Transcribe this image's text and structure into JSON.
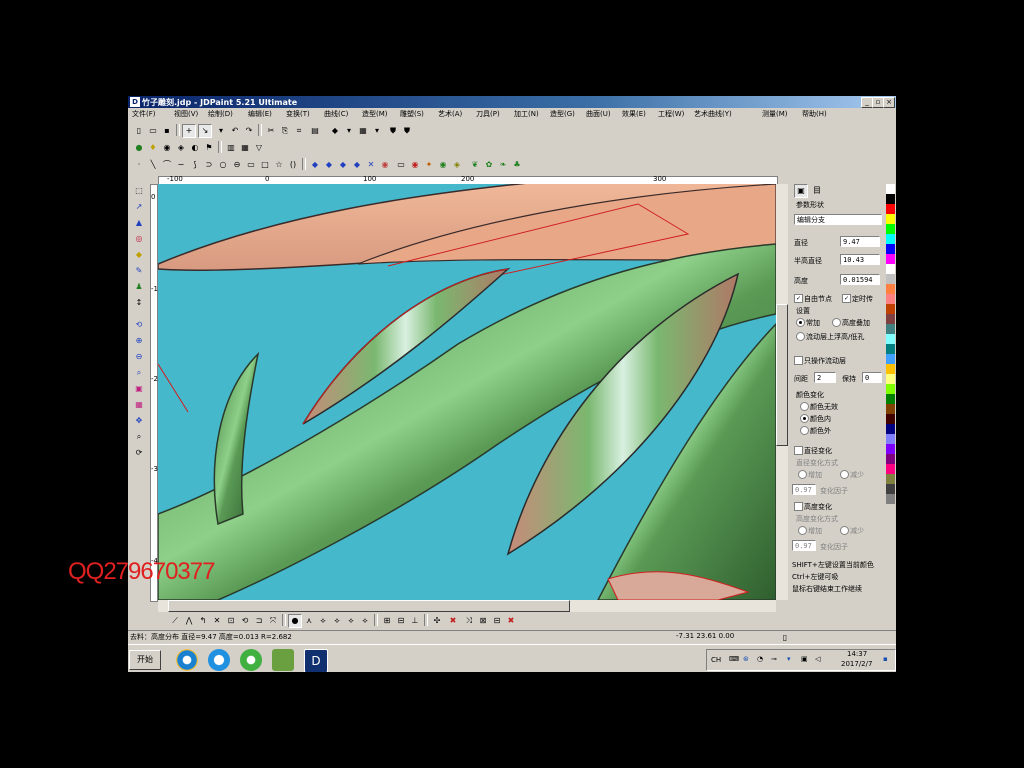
{
  "window": {
    "title": "竹子雕刻.jdp - JDPaint 5.21 Ultimate",
    "controls": [
      "_",
      "▫",
      "×"
    ]
  },
  "menu": [
    "文件(F)",
    "视图(V)",
    "绘制(D)",
    "编辑(E)",
    "变换(T)",
    "曲线(C)",
    "造型(M)",
    "雕塑(S)",
    "艺术(A)",
    "刀具(P)",
    "加工(N)",
    "造型(G)",
    "曲面(U)",
    "效果(E)",
    "工程(W)",
    "艺术曲线(Y)",
    "测量(M)",
    "帮助(H)"
  ],
  "ruler": {
    "h_ticks": [
      "-100",
      "0",
      "100",
      "200",
      "300"
    ],
    "v_ticks": [
      "0",
      "-1",
      "-2",
      "-3",
      "-4"
    ]
  },
  "panel": {
    "tabs": [
      "▣",
      "目"
    ],
    "section_title": "参数形状",
    "shape_select": "编辑分支",
    "fields": [
      {
        "label": "直径",
        "value": "9.47"
      },
      {
        "label": "半高直径",
        "value": "10.43"
      },
      {
        "label": "高度",
        "value": "0.01594"
      }
    ],
    "check_auto": "自由节点",
    "check_fixed": "定时传",
    "mode_group": "设置",
    "mode_options": [
      "常加",
      "高度叠加",
      "流动层上浮高/低孔"
    ],
    "check_only": "只操作流动层",
    "dist_label": "间距",
    "dist_value": "2",
    "hold_label": "保持",
    "hold_value": "0",
    "color_group": "颜色变化",
    "color_options": [
      "颜色无效",
      "颜色内",
      "颜色外"
    ],
    "check_straight": "直径变化",
    "sub1_title": "直径变化方式",
    "sub1_options": [
      "增加",
      "减少"
    ],
    "sub1_value": "0.97",
    "sub1_label": "变化因子",
    "check_height": "高度变化",
    "sub2_title": "高度变化方式",
    "sub2_options": [
      "增加",
      "减少"
    ],
    "sub2_value": "0.97",
    "sub2_label": "变化因子",
    "hints": [
      "SHIFT+左键设置当前颜色",
      "Ctrl+左键可吸",
      "鼠标右键结束工作继续"
    ]
  },
  "palette": [
    "#ffffff",
    "#000000",
    "#ff0000",
    "#ffff00",
    "#00ff00",
    "#00ffff",
    "#0000ff",
    "#ff00ff",
    "#ffffff",
    "#c0c0c0",
    "#ff8040",
    "#ff8080",
    "#c04000",
    "#804040",
    "#408080",
    "#80ffff",
    "#008080",
    "#40a0ff",
    "#ffc000",
    "#ffff80",
    "#80ff00",
    "#008000",
    "#804000",
    "#400000",
    "#000080",
    "#8080ff",
    "#8000ff",
    "#800080",
    "#ff0080",
    "#808040",
    "#404040",
    "#808080"
  ],
  "status": {
    "left": "去料：高度分布  直径=9.47  高度=0.013  R=2.682",
    "right": "-7.31 23.61 0.00"
  },
  "taskbar": {
    "start": "开始",
    "tray_lang": "CH",
    "time": "14:37",
    "date": "2017/2/7"
  },
  "overlay_text": "QQ279670377"
}
